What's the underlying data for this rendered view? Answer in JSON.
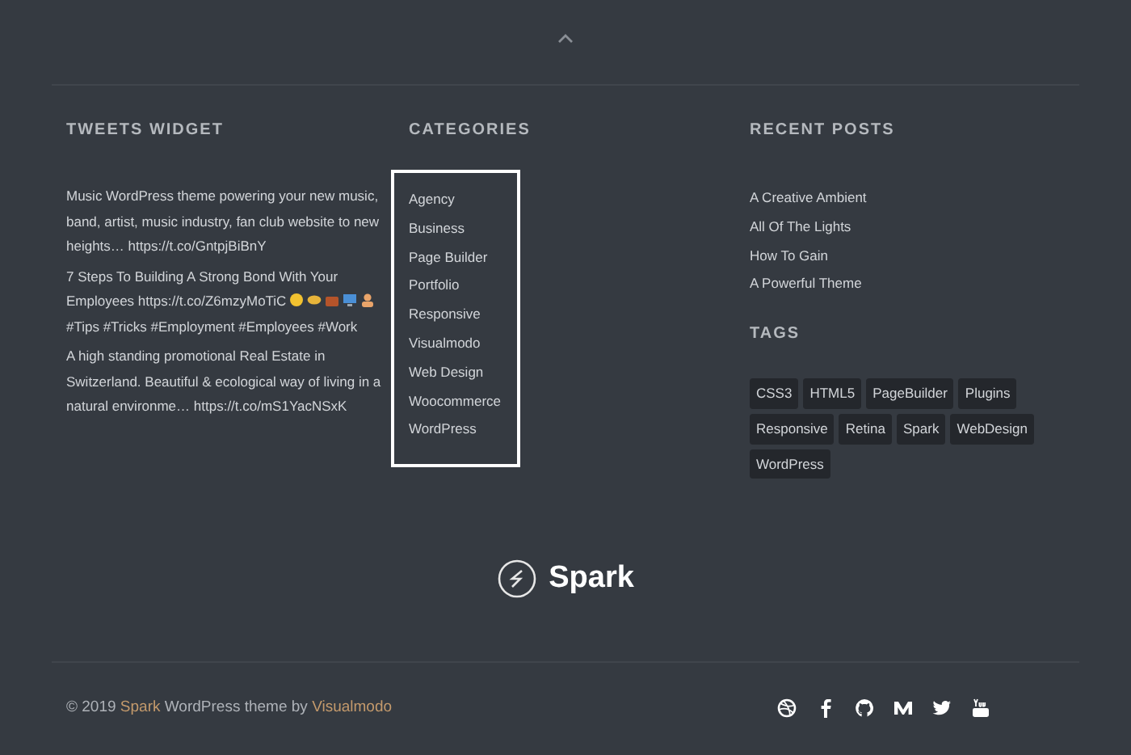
{
  "tweets": {
    "title": "TWEETS WIDGET",
    "items": [
      {
        "text": "Music WordPress theme powering your new music, band, artist, music industry, fan club website to new heights… https://t.co/GntpjBiBnY"
      },
      {
        "text": "7 Steps To Building A Strong Bond With Your Employees https://t.co/Z6mzyMoTiC",
        "emojis": [
          {
            "kind": "grin"
          },
          {
            "kind": "handshake"
          },
          {
            "kind": "briefcase"
          },
          {
            "kind": "computer"
          },
          {
            "kind": "person"
          }
        ],
        "after": "#Tips #Tricks #Employment #Employees #Work"
      },
      {
        "text": "A high standing promotional Real Estate in Switzerland. Beautiful & ecological way of living in a natural environme… https://t.co/mS1YacNSxK"
      }
    ]
  },
  "categories": {
    "title": "CATEGORIES",
    "highlighted": true,
    "items": [
      "Agency",
      "Business",
      "Page Builder",
      "Portfolio",
      "Responsive",
      "Visualmodo",
      "Web Design",
      "Woocommerce",
      "WordPress"
    ]
  },
  "recent_posts": {
    "title": "RECENT POSTS",
    "items": [
      "A Creative Ambient",
      "All Of The Lights",
      "How To Gain",
      "A Powerful Theme"
    ]
  },
  "tags": {
    "title": "TAGS",
    "items": [
      "CSS3",
      "HTML5",
      "PageBuilder",
      "Plugins",
      "Responsive",
      "Retina",
      "Spark",
      "WebDesign",
      "WordPress"
    ]
  },
  "logo": {
    "text": "Spark"
  },
  "footer": {
    "prefix": "© 2019",
    "link_1": "Spark",
    "middle": "WordPress theme by",
    "link_2": "Visualmodo",
    "social": [
      {
        "kind": "dribbble"
      },
      {
        "kind": "facebook"
      },
      {
        "kind": "github"
      },
      {
        "kind": "medium"
      },
      {
        "kind": "twitter"
      },
      {
        "kind": "youtube"
      }
    ]
  }
}
